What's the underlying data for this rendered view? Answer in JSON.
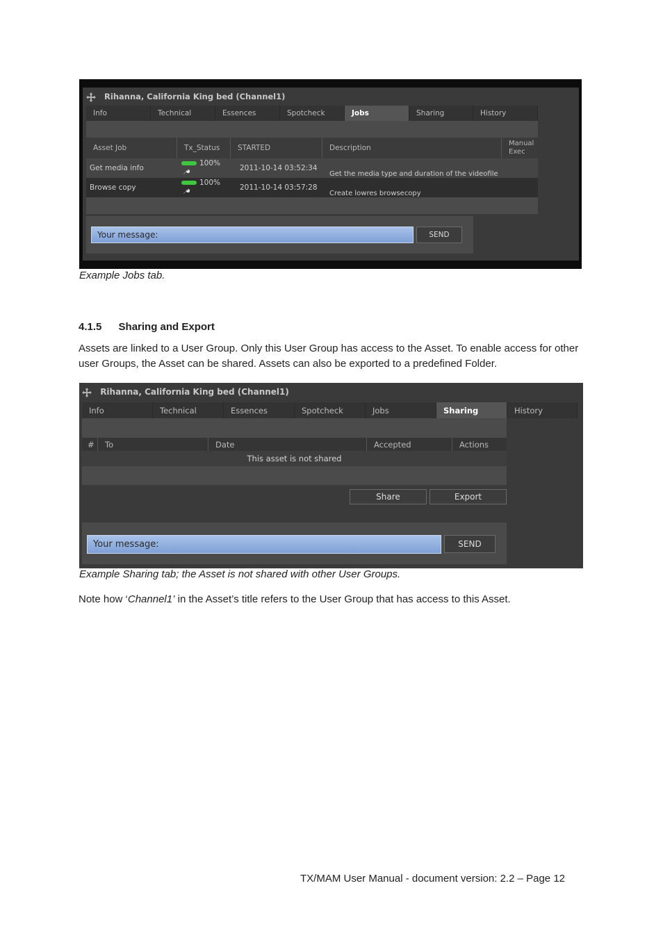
{
  "jobs_screenshot": {
    "title": "Rihanna, California King bed (Channel1)",
    "tabs": [
      {
        "label": "Info",
        "active": false
      },
      {
        "label": "Technical",
        "active": false
      },
      {
        "label": "Essences",
        "active": false
      },
      {
        "label": "Spotcheck",
        "active": false
      },
      {
        "label": "Jobs",
        "active": true
      },
      {
        "label": "Sharing",
        "active": false
      },
      {
        "label": "History",
        "active": false
      }
    ],
    "columns": [
      "Asset Job",
      "Tx_Status",
      "STARTED",
      "Description",
      "Manual Exec"
    ],
    "rows": [
      {
        "job": "Get media info",
        "status": "100%",
        "progress": 1.0,
        "started": "2011-10-14 03:52:34",
        "description": "Get the media type and duration of the videofile"
      },
      {
        "job": "Browse copy",
        "status": "100%",
        "progress": 1.0,
        "started": "2011-10-14 03:57:28",
        "description": "Create lowres browsecopy"
      }
    ],
    "message_placeholder": "Your message:",
    "send_label": "SEND"
  },
  "jobs_caption": "Example Jobs tab.",
  "section": {
    "number": "4.1.5",
    "title": "Sharing and Export",
    "paragraph": "Assets are linked to a User Group. Only this User Group has access to the Asset. To enable access for other user Groups, the Asset can be shared. Assets can also be exported to a predefined Folder."
  },
  "sharing_screenshot": {
    "title": "Rihanna, California King bed (Channel1)",
    "tabs": [
      {
        "label": "Info",
        "active": false
      },
      {
        "label": "Technical",
        "active": false
      },
      {
        "label": "Essences",
        "active": false
      },
      {
        "label": "Spotcheck",
        "active": false
      },
      {
        "label": "Jobs",
        "active": false
      },
      {
        "label": "Sharing",
        "active": true
      },
      {
        "label": "History",
        "active": false
      }
    ],
    "columns": [
      "#",
      "To",
      "Date",
      "Accepted",
      "Actions"
    ],
    "empty_text": "This asset is not shared",
    "share_label": "Share",
    "export_label": "Export",
    "message_placeholder": "Your message:",
    "send_label": "SEND"
  },
  "sharing_caption": "Example Sharing tab; the Asset is not shared with other User Groups.",
  "note": {
    "before": "Note how ‘",
    "emphasis": "Channel1’",
    "after": " in the Asset’s title refers to the User Group that has access to this Asset."
  },
  "footer": "TX/MAM User Manual - document version: 2.2 – Page 12",
  "colors": {
    "progress": "#3fc83f",
    "message_field": "#8fb0e0",
    "panel_bg": "#3a3a3a"
  }
}
